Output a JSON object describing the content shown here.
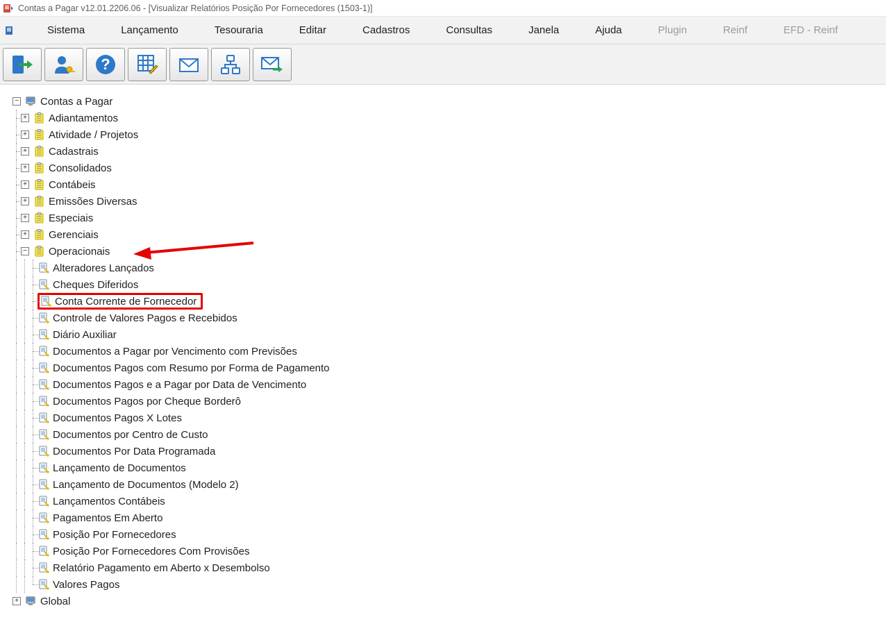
{
  "title": "Contas a Pagar v12.01.2206.06 - [Visualizar Relatórios Posição Por Fornecedores (1503-1)]",
  "menu": {
    "items": [
      {
        "label": "Sistema",
        "disabled": false
      },
      {
        "label": "Lançamento",
        "disabled": false
      },
      {
        "label": "Tesouraria",
        "disabled": false
      },
      {
        "label": "Editar",
        "disabled": false
      },
      {
        "label": "Cadastros",
        "disabled": false
      },
      {
        "label": "Consultas",
        "disabled": false
      },
      {
        "label": "Janela",
        "disabled": false
      },
      {
        "label": "Ajuda",
        "disabled": false
      },
      {
        "label": "Plugin",
        "disabled": true
      },
      {
        "label": "Reinf",
        "disabled": true
      },
      {
        "label": "EFD - Reinf",
        "disabled": true
      }
    ]
  },
  "toolbar": {
    "exit": "exit",
    "user": "user",
    "help": "help",
    "grid": "grid-edit",
    "mail": "mail",
    "network": "network",
    "mail_send": "mail-send"
  },
  "tree": {
    "root": {
      "label": "Contas a Pagar"
    },
    "root_children": [
      {
        "label": "Adiantamentos"
      },
      {
        "label": "Atividade / Projetos"
      },
      {
        "label": "Cadastrais"
      },
      {
        "label": "Consolidados"
      },
      {
        "label": "Contábeis"
      },
      {
        "label": "Emissões Diversas"
      },
      {
        "label": "Especiais"
      },
      {
        "label": "Gerenciais"
      },
      {
        "label": "Operacionais"
      }
    ],
    "operacionais_children": [
      {
        "label": "Alteradores Lançados"
      },
      {
        "label": "Cheques Diferidos"
      },
      {
        "label": "Conta Corrente de Fornecedor",
        "hl": true
      },
      {
        "label": "Controle de Valores Pagos e Recebidos"
      },
      {
        "label": "Diário Auxiliar"
      },
      {
        "label": "Documentos a Pagar por Vencimento com Previsões"
      },
      {
        "label": "Documentos Pagos com Resumo por Forma de Pagamento"
      },
      {
        "label": "Documentos Pagos e a Pagar por Data de Vencimento"
      },
      {
        "label": "Documentos Pagos por Cheque Borderô"
      },
      {
        "label": "Documentos Pagos X Lotes"
      },
      {
        "label": "Documentos por Centro de Custo"
      },
      {
        "label": "Documentos Por Data Programada"
      },
      {
        "label": "Lançamento de Documentos"
      },
      {
        "label": "Lançamento de Documentos (Modelo 2)"
      },
      {
        "label": "Lançamentos Contábeis"
      },
      {
        "label": "Pagamentos Em Aberto"
      },
      {
        "label": "Posição Por Fornecedores"
      },
      {
        "label": "Posição Por Fornecedores Com Provisões"
      },
      {
        "label": "Relatório Pagamento em Aberto x Desembolso"
      },
      {
        "label": "Valores Pagos"
      }
    ],
    "global": {
      "label": "Global"
    }
  }
}
